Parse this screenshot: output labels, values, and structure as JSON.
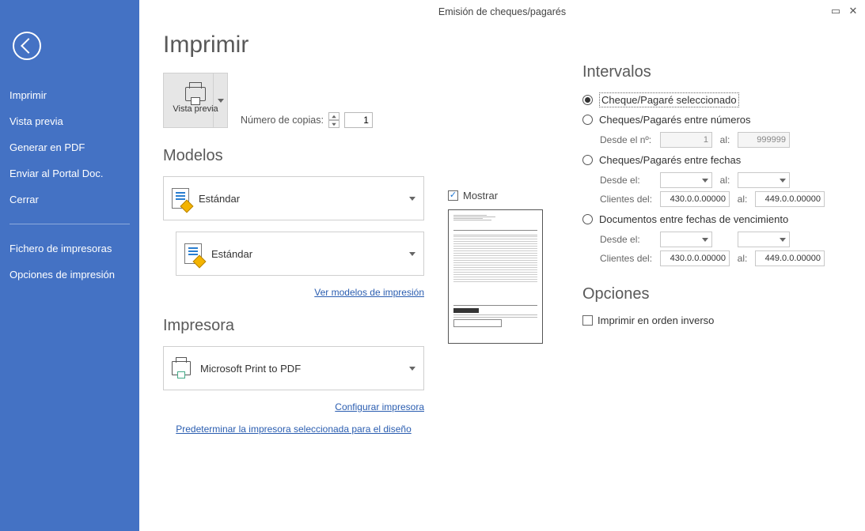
{
  "window": {
    "title": "Emisión de cheques/pagarés"
  },
  "sidebar": {
    "items": [
      "Imprimir",
      "Vista previa",
      "Generar en PDF",
      "Enviar al Portal Doc.",
      "Cerrar",
      "Fichero de impresoras",
      "Opciones de impresión"
    ]
  },
  "page_title": "Imprimir",
  "vista_previa_label": "Vista previa",
  "copies": {
    "label": "Número de copias:",
    "value": "1"
  },
  "models_heading": "Modelos",
  "model1": "Estándar",
  "model2": "Estándar",
  "ver_modelos_link": "Ver modelos de impresión",
  "impresora_heading": "Impresora",
  "printer_name": "Microsoft Print to PDF",
  "config_link": "Configurar impresora",
  "predeterminar_link": "Predeterminar la impresora seleccionada para el diseño",
  "mostrar_label": "Mostrar",
  "intervalos_heading": "Intervalos",
  "radio1": "Cheque/Pagaré seleccionado",
  "radio2": "Cheques/Pagarés entre números",
  "radio3": "Cheques/Pagarés entre fechas",
  "radio4": "Documentos entre fechas de vencimiento",
  "desde_n_label": "Desde el nº:",
  "desde_n_val": "1",
  "hasta_n_val": "999999",
  "al_label": "al:",
  "desde_el_label": "Desde el:",
  "clientes_label": "Clientes del:",
  "cli_from": "430.0.0.00000",
  "cli_to": "449.0.0.00000",
  "opciones_heading": "Opciones",
  "inverso_label": "Imprimir en orden inverso"
}
